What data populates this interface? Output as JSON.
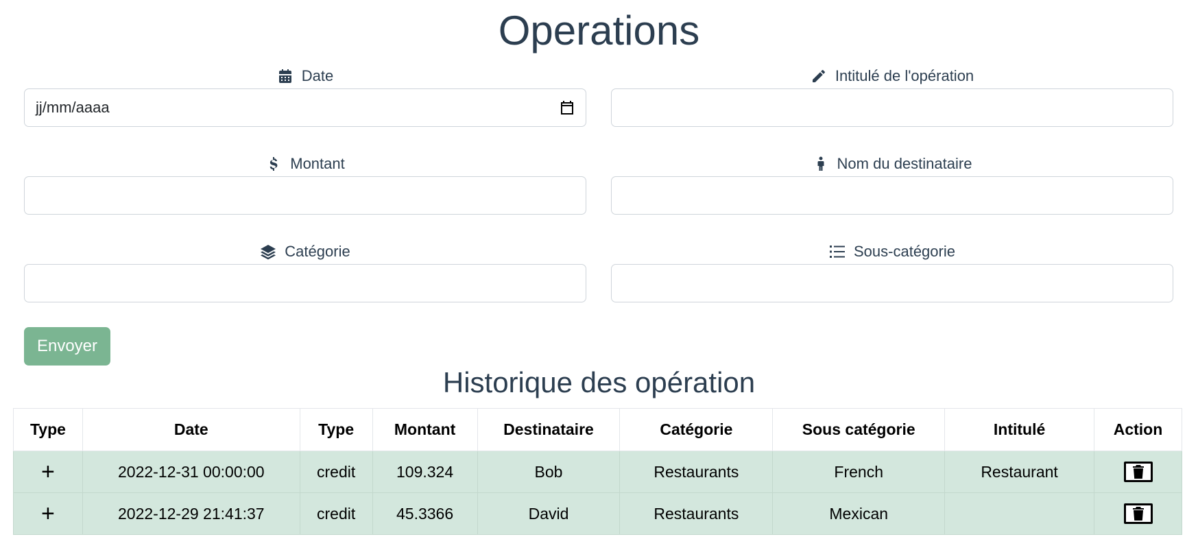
{
  "page": {
    "title": "Operations"
  },
  "form": {
    "date": {
      "label": "Date",
      "placeholder": "jj/mm/aaaa",
      "icon": "calendar-icon"
    },
    "intitule": {
      "label": "Intitulé de l'opération",
      "value": "",
      "icon": "pencil-icon"
    },
    "montant": {
      "label": "Montant",
      "value": "",
      "icon": "dollar-icon"
    },
    "destinataire": {
      "label": "Nom du destinataire",
      "value": "",
      "icon": "person-icon"
    },
    "categorie": {
      "label": "Catégorie",
      "value": "",
      "icon": "layers-icon"
    },
    "sous_categorie": {
      "label": "Sous-catégorie",
      "value": "",
      "icon": "list-icon"
    },
    "submit_label": "Envoyer",
    "submit_color": "#7bb592"
  },
  "history": {
    "title": "Historique des opération",
    "headers": [
      "Type",
      "Date",
      "Type",
      "Montant",
      "Destinataire",
      "Catégorie",
      "Sous catégorie",
      "Intitulé",
      "Action"
    ],
    "row_color": "#d3e7dd",
    "rows": [
      {
        "sign": "+",
        "date": "2022-12-31 00:00:00",
        "type": "credit",
        "montant": "109.324",
        "destinataire": "Bob",
        "categorie": "Restaurants",
        "sous_categorie": "French",
        "intitule": "Restaurant"
      },
      {
        "sign": "+",
        "date": "2022-12-29 21:41:37",
        "type": "credit",
        "montant": "45.3366",
        "destinataire": "David",
        "categorie": "Restaurants",
        "sous_categorie": "Mexican",
        "intitule": ""
      }
    ]
  }
}
